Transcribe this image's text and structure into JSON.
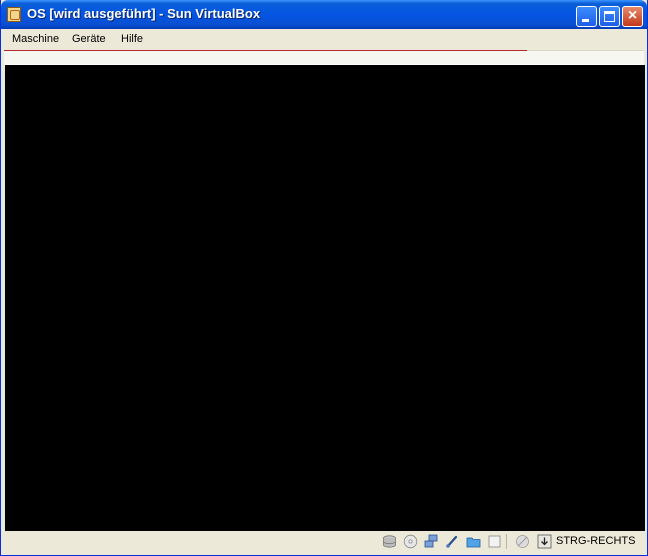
{
  "window": {
    "title": "OS [wird ausgeführt] - Sun VirtualBox",
    "icon": "virtualbox-app-icon"
  },
  "titlebar_buttons": {
    "minimize_icon": "minimize-icon",
    "maximize_icon": "maximize-icon",
    "close_icon": "close-icon"
  },
  "menubar": {
    "items": [
      {
        "label": "Maschine"
      },
      {
        "label": "Geräte"
      },
      {
        "label": "Hilfe"
      }
    ]
  },
  "statusbar": {
    "icons": [
      "hard-disk-icon",
      "cd-dvd-icon",
      "network-icon",
      "usb-icon",
      "shared-folders-icon",
      "display-icon",
      "mouse-integration-icon",
      "keyboard-capture-icon"
    ],
    "host_key": "STRG-RECHTS"
  },
  "colors": {
    "titlebar_blue": "#0554e3",
    "screen_bg": "#000000",
    "chrome_bg": "#ece9d8",
    "close_red": "#c2391a"
  }
}
